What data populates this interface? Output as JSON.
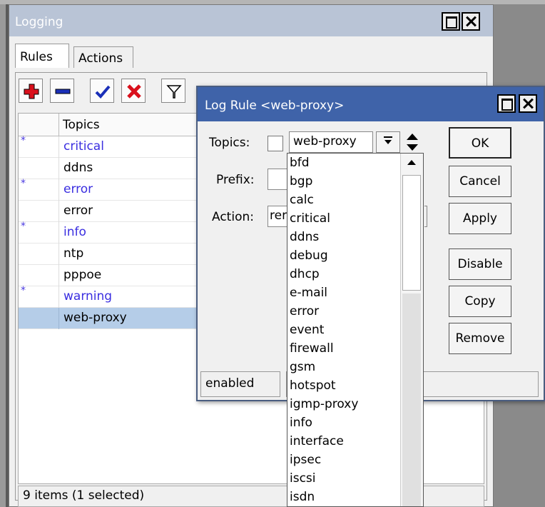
{
  "logging_window": {
    "title": "Logging",
    "tabs": [
      {
        "label": "Rules",
        "active": true
      },
      {
        "label": "Actions",
        "active": false
      }
    ],
    "toolbar": [
      "add-icon",
      "remove-icon",
      "enable-icon",
      "disable-icon",
      "filter-icon"
    ],
    "table": {
      "column": "Topics",
      "rows": [
        {
          "marker": "*",
          "topic": "critical",
          "dynamic": true,
          "selected": false
        },
        {
          "marker": "",
          "topic": "ddns",
          "dynamic": false,
          "selected": false
        },
        {
          "marker": "*",
          "topic": "error",
          "dynamic": true,
          "selected": false
        },
        {
          "marker": "",
          "topic": "error",
          "dynamic": false,
          "selected": false
        },
        {
          "marker": "*",
          "topic": "info",
          "dynamic": true,
          "selected": false
        },
        {
          "marker": "",
          "topic": "ntp",
          "dynamic": false,
          "selected": false
        },
        {
          "marker": "",
          "topic": "pppoe",
          "dynamic": false,
          "selected": false
        },
        {
          "marker": "*",
          "topic": "warning",
          "dynamic": true,
          "selected": false
        },
        {
          "marker": "",
          "topic": "web-proxy",
          "dynamic": false,
          "selected": true
        }
      ]
    },
    "status": "9 items (1 selected)"
  },
  "dialog": {
    "title": "Log Rule <web-proxy>",
    "topics_label": "Topics:",
    "topics_value": "web-proxy",
    "prefix_label": "Prefix:",
    "action_label": "Action:",
    "action_value": "rer",
    "buttons": {
      "ok": "OK",
      "cancel": "Cancel",
      "apply": "Apply",
      "disable": "Disable",
      "copy": "Copy",
      "remove": "Remove"
    },
    "status": "enabled"
  },
  "dropdown_options": [
    "bfd",
    "bgp",
    "calc",
    "critical",
    "ddns",
    "debug",
    "dhcp",
    "e-mail",
    "error",
    "event",
    "firewall",
    "gsm",
    "hotspot",
    "igmp-proxy",
    "info",
    "interface",
    "ipsec",
    "iscsi",
    "isdn"
  ],
  "colors": {
    "dialog_title": "#3f63a9",
    "inactive_title": "#b9c4d6",
    "dynamic_text": "#3a2ee0",
    "selected_row": "#b5cde8"
  }
}
